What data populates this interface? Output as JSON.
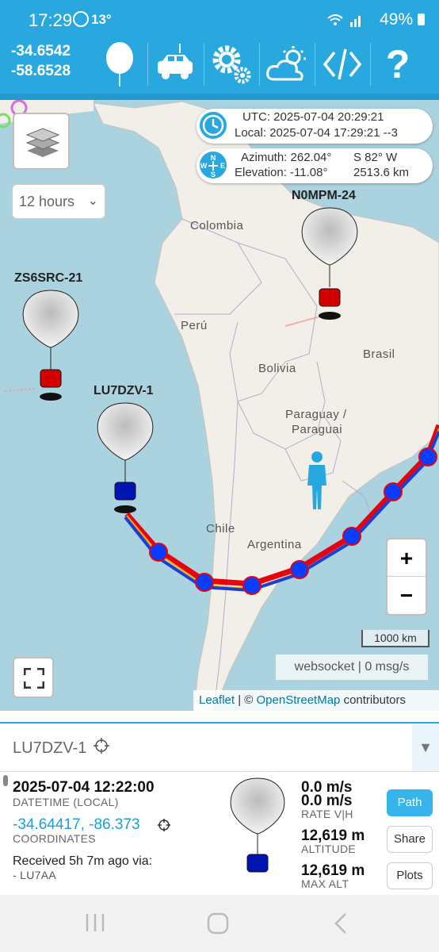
{
  "status_bar": {
    "time": "17:29",
    "temperature": "13°",
    "battery": "49%",
    "icons": [
      "whatsapp-icon",
      "wifi-icon",
      "signal-icon",
      "battery-icon"
    ]
  },
  "toolbar": {
    "latitude": "-34.6542",
    "longitude": "-58.6528",
    "tools": [
      "balloon-icon",
      "car-icon",
      "settings-gears-icon",
      "weather-icon",
      "code-icon",
      "help-icon"
    ],
    "help_glyph": "?"
  },
  "map": {
    "time_info": {
      "utc": "UTC: 2025-07-04 20:29:21",
      "local": "Local: 2025-07-04 17:29:21 --3"
    },
    "look_angles": {
      "azimuth": "Azimuth: 262.04°",
      "direction": "S 82° W",
      "elevation": "Elevation: -11.08°",
      "distance": "2513.6 km"
    },
    "time_range": {
      "value": "12 hours"
    },
    "places": {
      "colombia": "Colombia",
      "peru": "Perú",
      "brasil": "Brasil",
      "bolivia": "Bolivia",
      "paraguay": "Paraguay /",
      "paraguai": "Paraguai",
      "chile": "Chile",
      "argentina": "Argentina"
    },
    "balloons": {
      "n0mpm": "N0MPM-24",
      "zs6src": "ZS6SRC-21",
      "lu7dzv": "LU7DZV-1"
    },
    "zoom_in": "+",
    "zoom_out": "−",
    "scale": "1000 km",
    "websocket": "websocket | 0 msg/s",
    "attribution": {
      "leaflet": "Leaflet",
      "sep": " | © ",
      "osm": "OpenStreetMap",
      "suffix": " contributors"
    },
    "colors": {
      "water": "#aad3df",
      "land": "#f2efe9",
      "track_red": "#e8000e",
      "track_blue": "#1a3fd8",
      "marker": "#0a3cff"
    }
  },
  "panel": {
    "callsign": "LU7DZV-1",
    "expand_glyph": "▼",
    "datetime": "2025-07-04 12:22:00",
    "datetime_label": "DATETIME (LOCAL)",
    "coordinates": "-34.64417, -86.373",
    "coordinates_label": "COORDINATES",
    "received": "Received 5h 7m ago via:",
    "via": "- LU7AA",
    "rate_v": "0.0 m/s",
    "rate_h": "0.0 m/s",
    "rate_label": "RATE V|H",
    "altitude": "12,619 m",
    "altitude_label": "ALTITUDE",
    "max_alt": "12,619 m",
    "max_alt_label": "MAX ALT",
    "buttons": {
      "path": "Path",
      "share": "Share",
      "plots": "Plots"
    }
  },
  "nav_bar": {
    "icons": [
      "recent-apps-icon",
      "home-icon",
      "back-icon"
    ]
  }
}
